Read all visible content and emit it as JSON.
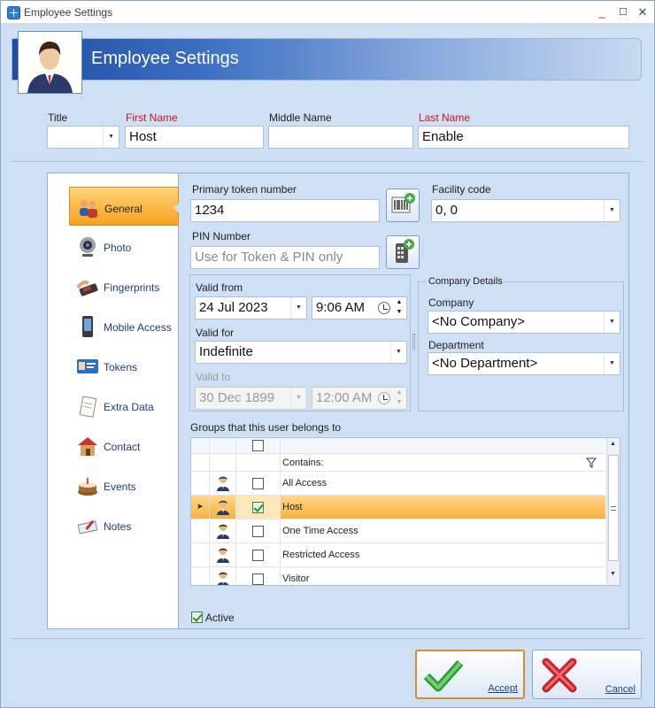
{
  "window": {
    "title": "Employee Settings",
    "controls": [
      "_",
      "☐",
      "✕"
    ]
  },
  "header": {
    "title": "Employee Settings"
  },
  "name_fields": {
    "title_label": "Title",
    "title_value": "",
    "first_label": "First Name",
    "first_value": "Host",
    "middle_label": "Middle Name",
    "middle_value": "",
    "last_label": "Last Name",
    "last_value": "Enable"
  },
  "nav": {
    "items": [
      {
        "label": "General",
        "icon": "group-icon",
        "selected": true
      },
      {
        "label": "Photo",
        "icon": "webcam-icon"
      },
      {
        "label": "Fingerprints",
        "icon": "fingerprint-reader-icon"
      },
      {
        "label": "Mobile Access",
        "icon": "mobile-phone-icon"
      },
      {
        "label": "Tokens",
        "icon": "id-card-icon"
      },
      {
        "label": "Extra Data",
        "icon": "notepad-icon"
      },
      {
        "label": "Contact",
        "icon": "house-icon"
      },
      {
        "label": "Events",
        "icon": "cake-icon"
      },
      {
        "label": "Notes",
        "icon": "notes-icon"
      }
    ]
  },
  "general": {
    "token_label": "Primary token number",
    "token_value": "1234",
    "facility_label": "Facility code",
    "facility_value": "0, 0",
    "pin_label": "PIN Number",
    "pin_placeholder": "Use for Token & PIN only",
    "valid_from_label": "Valid from",
    "valid_from_date": "24 Jul 2023",
    "valid_from_time": "9:06 AM",
    "valid_for_label": "Valid for",
    "valid_for_value": "Indefinite",
    "valid_to_label": "Valid to",
    "valid_to_date": "30 Dec 1899",
    "valid_to_time": "12:00 AM",
    "company_group_title": "Company Details",
    "company_label": "Company",
    "company_value": "<No Company>",
    "department_label": "Department",
    "department_value": "<No Department>",
    "groups_label": "Groups that this user belongs to",
    "filter_label": "Contains:",
    "groups": [
      {
        "name": "All Access",
        "checked": false,
        "current": false
      },
      {
        "name": "Host",
        "checked": true,
        "current": true
      },
      {
        "name": "One Time Access",
        "checked": false,
        "current": false
      },
      {
        "name": "Restricted Access",
        "checked": false,
        "current": false
      },
      {
        "name": "Visitor",
        "checked": false,
        "current": false
      }
    ],
    "active_label": "Active",
    "active_checked": true
  },
  "buttons": {
    "accept": "Accept",
    "cancel": "Cancel"
  },
  "colors": {
    "accent_orange": "#f6a21e",
    "panel_bg": "#cfdff4",
    "header_blue": "#1f4aa0",
    "required_red": "#d0131b"
  }
}
